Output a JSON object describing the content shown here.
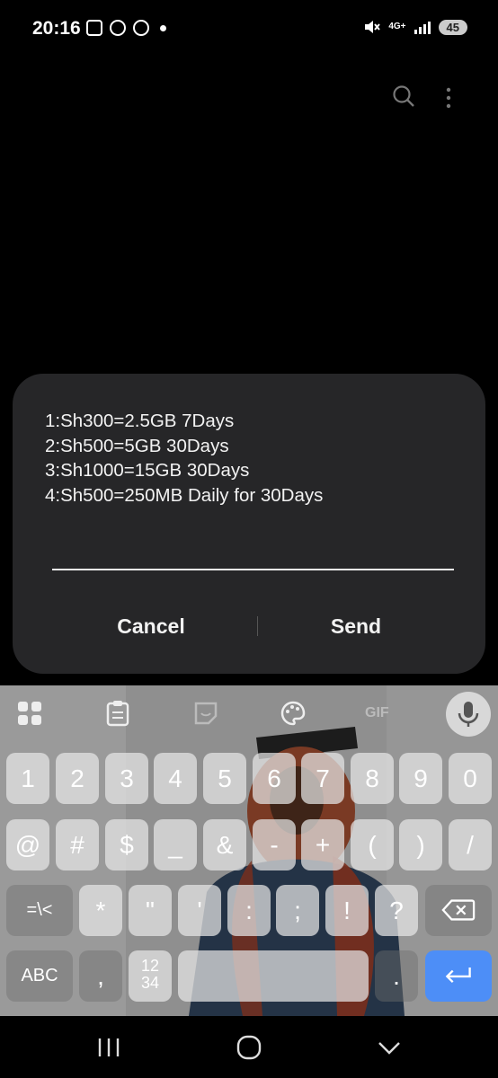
{
  "status_bar": {
    "time": "20:16",
    "network": "4G+",
    "battery": "45"
  },
  "dialog": {
    "message_lines": [
      "1:Sh300=2.5GB 7Days",
      "2:Sh500=5GB 30Days",
      "3:Sh1000=15GB 30Days",
      "4:Sh500=250MB Daily for 30Days"
    ],
    "input_value": "",
    "cancel_label": "Cancel",
    "send_label": "Send"
  },
  "keyboard": {
    "gif_label": "GIF",
    "row1": [
      "1",
      "2",
      "3",
      "4",
      "5",
      "6",
      "7",
      "8",
      "9",
      "0"
    ],
    "row2": [
      "@",
      "#",
      "$",
      "_",
      "&",
      "-",
      "+",
      "(",
      ")",
      "/"
    ],
    "row3": [
      "=\\<",
      "*",
      "\"",
      "'",
      ":",
      ";",
      "!",
      "?"
    ],
    "abc_label": "ABC",
    "comma": ",",
    "numpad_label_top": "12",
    "numpad_label_bottom": "34",
    "period": "."
  },
  "icons": [
    "search-icon",
    "more-vert-icon",
    "emoji-grid-icon",
    "clipboard-icon",
    "sticker-icon",
    "palette-icon",
    "mic-icon",
    "backspace-icon",
    "enter-icon",
    "recent-apps-icon",
    "home-icon",
    "back-icon"
  ],
  "colors": {
    "dialog_bg": "#262628",
    "enter_key": "#4d8ef7"
  }
}
